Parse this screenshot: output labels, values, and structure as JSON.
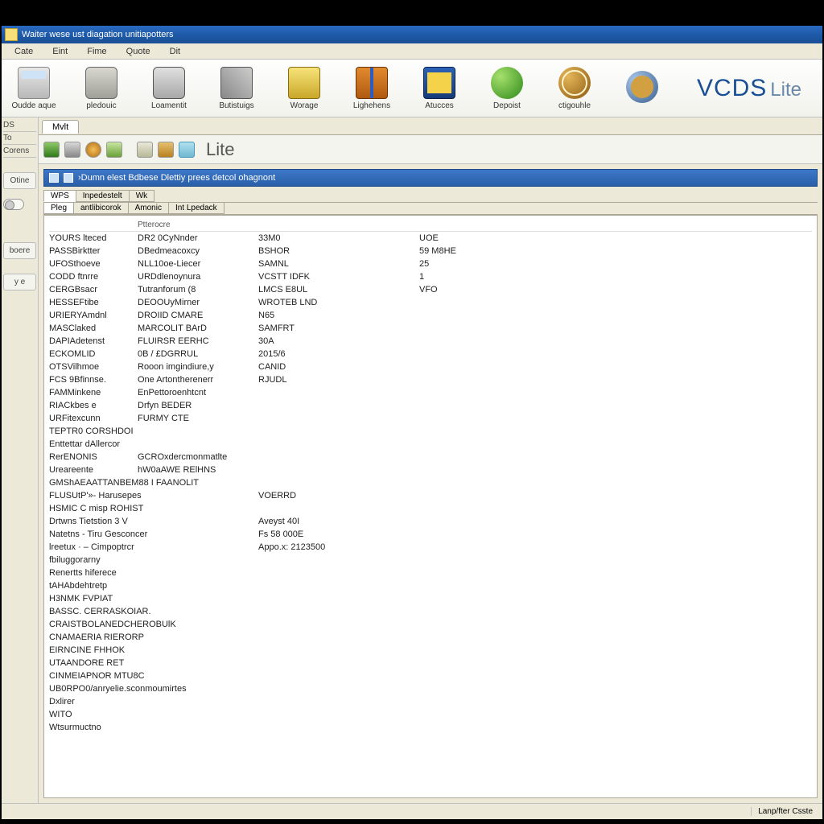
{
  "titlebar": {
    "text": "Waiter wese ust diagation unitiapotters"
  },
  "menu": {
    "items": [
      "Cate",
      "Eint",
      "Fime",
      "Quote",
      "Dit"
    ]
  },
  "toolbar": {
    "items": [
      {
        "label": "Oudde aque",
        "icon": "ic-printer"
      },
      {
        "label": "pledouic",
        "icon": "ic-drum"
      },
      {
        "label": "Loamentit",
        "icon": "ic-phone"
      },
      {
        "label": "Butistuigs",
        "icon": "ic-cube"
      },
      {
        "label": "Worage",
        "icon": "ic-book"
      },
      {
        "label": "Lighehens",
        "icon": "ic-box"
      },
      {
        "label": "Atucces",
        "icon": "ic-case"
      },
      {
        "label": "Depoist",
        "icon": "ic-ball"
      },
      {
        "label": "ctigouhle",
        "icon": "ic-globe"
      },
      {
        "label": "",
        "icon": "ic-orb"
      }
    ],
    "brand_big": "VCDS",
    "brand_lite": "Lite"
  },
  "leftnav": {
    "head1": "DS",
    "head2": "To",
    "head3": "Corens",
    "btn1": "Otine",
    "btn2": "boere",
    "btn3": "y e"
  },
  "workspace": {
    "tab": "Mvlt",
    "mini_label": "Lite",
    "subheader": "›Dumn elest Bdbese Dlettiy prees detcol ohagnont",
    "tabs_row1": [
      "WPS",
      "Inpedestelt",
      "Wk"
    ],
    "tabs_row2": [
      "Pleg",
      "antlibicorok",
      "Amonic",
      "Int Lpedack"
    ],
    "header_row": [
      "",
      "Ptterocre",
      "",
      ""
    ]
  },
  "data": {
    "rows4": [
      {
        "c1": "YOURS lteced",
        "c2": "DR2 0CyNnder",
        "c3": "33M0",
        "c4": "UOE"
      },
      {
        "c1": "PASSBirktter",
        "c2": "DBedmeacoxcy",
        "c3": "BSHOR",
        "c4": "59 M8HE"
      },
      {
        "c1": "UFOSthoeve",
        "c2": "NLL10oe-Liecer",
        "c3": "SAMNL",
        "c4": "25"
      },
      {
        "c1": "CODD ftnrre",
        "c2": "URDdlenoynura",
        "c3": "VCSTT IDFK",
        "c4": "1"
      },
      {
        "c1": "CERGBsacr",
        "c2": "Tutranforum (8",
        "c3": "LMCS E8UL",
        "c4": "VFO"
      },
      {
        "c1": "HESSEFtibe",
        "c2": "DEOOUyMirner",
        "c3": "WROTEB LND",
        "c4": ""
      },
      {
        "c1": "URIERYAmdnl",
        "c2": "DROIID CMARE",
        "c3": "N65",
        "c4": ""
      },
      {
        "c1": "MASClaked",
        "c2": "MARCOLIT BArD",
        "c3": "SAMFRT",
        "c4": ""
      },
      {
        "c1": "DAPIAdetenst",
        "c2": "FLUIRSR EERHC",
        "c3": "30A",
        "c4": ""
      },
      {
        "c1": "ECKOMLID",
        "c2": "0B / £DGRRUL",
        "c3": "2015/6",
        "c4": ""
      },
      {
        "c1": "OTSVilhmoe",
        "c2": "Rooon imgindiure,y",
        "c3": "CANID",
        "c4": ""
      },
      {
        "c1": "FCS 9Bfinnse.",
        "c2": "One Artontherenerr",
        "c3": "RJUDL",
        "c4": ""
      },
      {
        "c1": "FAMMinkene",
        "c2": "EnPettoroenhtcnt",
        "c3": "",
        "c4": ""
      },
      {
        "c1": "RIACkbes e",
        "c2": "Drfyn BEDER",
        "c3": "",
        "c4": ""
      },
      {
        "c1": "URFitexcunn",
        "c2": "FURMY CTE",
        "c3": "",
        "c4": ""
      }
    ],
    "single_rows_a": [
      "TEPTR0 CORSHDOI",
      "Enttettar dAllercor"
    ],
    "rows2": [
      {
        "c1": "RerENONIS",
        "c2": "GCROxdercmonmatlte"
      },
      {
        "c1": "Ureareente",
        "c2": "hW0aAWE RElHNS"
      }
    ],
    "single_rows_b": [
      "GMShAEAATTANBEM88 I FAANOLIT"
    ],
    "kv_rows": [
      {
        "k": "FLUSUtP'»- Harusepes",
        "v": "VOERRD"
      },
      {
        "k": "HSMIC   C misp ROHIST",
        "v": ""
      },
      {
        "k": "Drtwns       Tietstion 3 V",
        "v": "Aveyst 40I"
      },
      {
        "k": "Natetns - Tiru Gesconcer",
        "v": "Fs 58 000E"
      },
      {
        "k": "lreetux  · – Cimpoptrcr",
        "v": "Appo.x: 2123500"
      }
    ],
    "single_rows_c": [
      "fbiluggorarny",
      "Renertts hiferece",
      "tAHAbdehtretp",
      "H3NMK FVPIAT",
      "BASSC. CERRASKOIAR.",
      "CRAISTBOLANEDCHEROBUlK",
      "CNAMAERIA RIERORP",
      "EIRNCINE FHHOK",
      "UTAANDORE RET",
      "CINMEIAPNOR MTU8C",
      "UB0RPO0/anryelie.sconmoumirtes",
      "Dxlirer",
      "WITO",
      "Wtsurmuctno"
    ]
  },
  "statusbar": {
    "right": "Lanp/fter Csste"
  }
}
